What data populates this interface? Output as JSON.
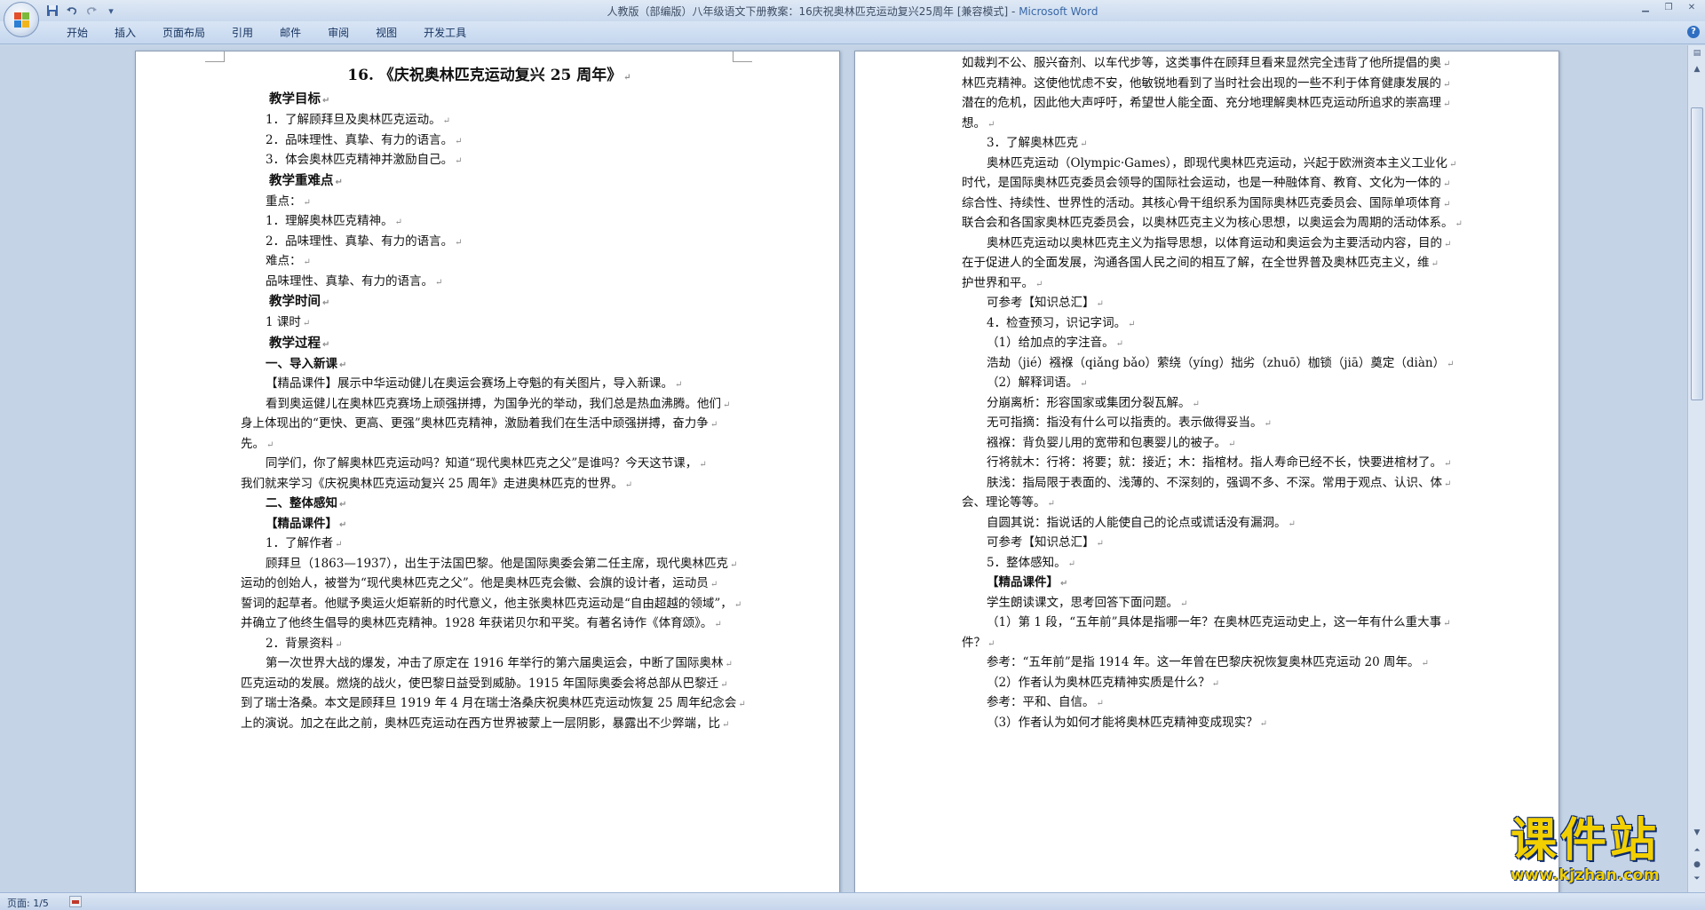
{
  "window": {
    "title_doc": "人教版（部编版）八年级语文下册教案：16庆祝奥林匹克运动复兴25周年 [兼容模式] - ",
    "title_app": "Microsoft Word"
  },
  "quick_access": {
    "icons": [
      "save-icon",
      "undo-icon",
      "redo-icon",
      "customize-qat-icon"
    ]
  },
  "ribbon": {
    "tabs": [
      "开始",
      "插入",
      "页面布局",
      "引用",
      "邮件",
      "审阅",
      "视图",
      "开发工具"
    ]
  },
  "document": {
    "left_page": {
      "title": "16. 《庆祝奥林匹克运动复兴 25 周年》",
      "lines": [
        {
          "t": "h",
          "text": "教学目标"
        },
        {
          "t": "i",
          "text": "1．了解顾拜旦及奥林匹克运动。"
        },
        {
          "t": "i",
          "text": "2．品味理性、真挚、有力的语言。"
        },
        {
          "t": "i",
          "text": "3．体会奥林匹克精神并激励自己。"
        },
        {
          "t": "h",
          "text": "教学重难点"
        },
        {
          "t": "i",
          "text": "重点："
        },
        {
          "t": "i",
          "text": "1．理解奥林匹克精神。"
        },
        {
          "t": "i",
          "text": "2．品味理性、真挚、有力的语言。"
        },
        {
          "t": "i",
          "text": "难点："
        },
        {
          "t": "i",
          "text": "品味理性、真挚、有力的语言。"
        },
        {
          "t": "h",
          "text": "教学时间"
        },
        {
          "t": "i",
          "text": "1 课时"
        },
        {
          "t": "h",
          "text": "教学过程"
        },
        {
          "t": "hs",
          "text": "一、导入新课"
        },
        {
          "t": "i",
          "text": "【精品课件】展示中华运动健儿在奥运会赛场上夺魁的有关图片，导入新课。"
        },
        {
          "t": "p",
          "text": "看到奥运健儿在奥林匹克赛场上顽强拼搏，为国争光的举动，我们总是热血沸腾。他们"
        },
        {
          "t": "c",
          "text": "身上体现出的“更快、更高、更强”奥林匹克精神，激励着我们在生活中顽强拼搏，奋力争"
        },
        {
          "t": "c",
          "text": "先。"
        },
        {
          "t": "p",
          "text": "同学们，你了解奥林匹克运动吗？知道“现代奥林匹克之父”是谁吗？今天这节课，"
        },
        {
          "t": "c",
          "text": "我们就来学习《庆祝奥林匹克运动复兴 25 周年》走进奥林匹克的世界。"
        },
        {
          "t": "hs",
          "text": "二、整体感知"
        },
        {
          "t": "hs",
          "text": "【精品课件】"
        },
        {
          "t": "i",
          "text": "1．了解作者"
        },
        {
          "t": "p",
          "text": "顾拜旦（1863—1937），出生于法国巴黎。他是国际奥委会第二任主席，现代奥林匹克"
        },
        {
          "t": "c",
          "text": "运动的创始人，被誉为“现代奥林匹克之父”。他是奥林匹克会徽、会旗的设计者，运动员"
        },
        {
          "t": "c",
          "text": "誓词的起草者。他赋予奥运火炬崭新的时代意义，他主张奥林匹克运动是“自由超越的领域”，"
        },
        {
          "t": "c",
          "text": "并确立了他终生倡导的奥林匹克精神。1928 年获诺贝尔和平奖。有著名诗作《体育颂》。"
        },
        {
          "t": "i",
          "text": "2．背景资料"
        },
        {
          "t": "p",
          "text": "第一次世界大战的爆发，冲击了原定在 1916 年举行的第六届奥运会，中断了国际奥林"
        },
        {
          "t": "c",
          "text": "匹克运动的发展。燃烧的战火，使巴黎日益受到威胁。1915 年国际奥委会将总部从巴黎迁"
        },
        {
          "t": "c",
          "text": "到了瑞士洛桑。本文是顾拜旦 1919 年 4 月在瑞士洛桑庆祝奥林匹克运动恢复 25 周年纪念会"
        },
        {
          "t": "c",
          "text": "上的演说。加之在此之前，奥林匹克运动在西方世界被蒙上一层阴影，暴露出不少弊端，比"
        }
      ]
    },
    "right_page": {
      "lines": [
        {
          "t": "c",
          "text": "如裁判不公、服兴奋剂、以车代步等，这类事件在顾拜旦看来显然完全违背了他所提倡的奥"
        },
        {
          "t": "c",
          "text": "林匹克精神。这使他忧虑不安，他敏锐地看到了当时社会出现的一些不利于体育健康发展的"
        },
        {
          "t": "c",
          "text": "潜在的危机，因此他大声呼吁，希望世人能全面、充分地理解奥林匹克运动所追求的崇高理"
        },
        {
          "t": "c",
          "text": "想。"
        },
        {
          "t": "i",
          "text": "3．了解奥林匹克"
        },
        {
          "t": "p",
          "text": "奥林匹克运动（Olympic·Games），即现代奥林匹克运动，兴起于欧洲资本主义工业化"
        },
        {
          "t": "c",
          "text": "时代，是国际奥林匹克委员会领导的国际社会运动，也是一种融体育、教育、文化为一体的"
        },
        {
          "t": "c",
          "text": "综合性、持续性、世界性的活动。其核心骨干组织系为国际奥林匹克委员会、国际单项体育"
        },
        {
          "t": "c",
          "text": "联合会和各国家奥林匹克委员会，以奥林匹克主义为核心思想，以奥运会为周期的活动体系。"
        },
        {
          "t": "p",
          "text": "奥林匹克运动以奥林匹克主义为指导思想，以体育运动和奥运会为主要活动内容，目的"
        },
        {
          "t": "c",
          "text": "在于促进人的全面发展，沟通各国人民之间的相互了解，在全世界普及奥林匹克主义，维"
        },
        {
          "t": "c",
          "text": "护世界和平。"
        },
        {
          "t": "i",
          "text": "可参考【知识总汇】"
        },
        {
          "t": "i",
          "text": "4．检查预习，识记字词。"
        },
        {
          "t": "i",
          "text": "（1）给加点的字注音。"
        },
        {
          "t": "i",
          "text": "浩劫（jié）襁褓（qiǎng bǎo）萦绕（yíng）拙劣（zhuō）枷锁（jiā）奠定（diàn）"
        },
        {
          "t": "i",
          "text": "（2）解释词语。"
        },
        {
          "t": "i",
          "text": "分崩离析：形容国家或集团分裂瓦解。"
        },
        {
          "t": "i",
          "text": "无可指摘：指没有什么可以指责的。表示做得妥当。"
        },
        {
          "t": "i",
          "text": "襁褓：背负婴儿用的宽带和包裹婴儿的被子。"
        },
        {
          "t": "i",
          "text": "行将就木：行将：将要；就：接近；木：指棺材。指人寿命已经不长，快要进棺材了。"
        },
        {
          "t": "p",
          "text": "肤浅：指局限于表面的、浅薄的、不深刻的，强调不多、不深。常用于观点、认识、体"
        },
        {
          "t": "c",
          "text": "会、理论等等。"
        },
        {
          "t": "i",
          "text": "自圆其说：指说话的人能使自己的论点或谎话没有漏洞。"
        },
        {
          "t": "i",
          "text": "可参考【知识总汇】"
        },
        {
          "t": "i",
          "text": "5．整体感知。"
        },
        {
          "t": "hs",
          "text": "【精品课件】"
        },
        {
          "t": "i",
          "text": "学生朗读课文，思考回答下面问题。"
        },
        {
          "t": "p",
          "text": "（1）第 1 段，“五年前”具体是指哪一年？在奥林匹克运动史上，这一年有什么重大事"
        },
        {
          "t": "c",
          "text": "件？"
        },
        {
          "t": "i",
          "text": "参考：“五年前”是指 1914 年。这一年曾在巴黎庆祝恢复奥林匹克运动 20 周年。"
        },
        {
          "t": "i",
          "text": "（2）作者认为奥林匹克精神实质是什么？"
        },
        {
          "t": "i",
          "text": "参考：平和、自信。"
        },
        {
          "t": "i",
          "text": "（3）作者认为如何才能将奥林匹克精神变成现实？"
        }
      ]
    }
  },
  "statusbar": {
    "page": "页面: 1/5"
  },
  "watermark": {
    "main": "课件站",
    "url": "www.kjzhan.com"
  }
}
